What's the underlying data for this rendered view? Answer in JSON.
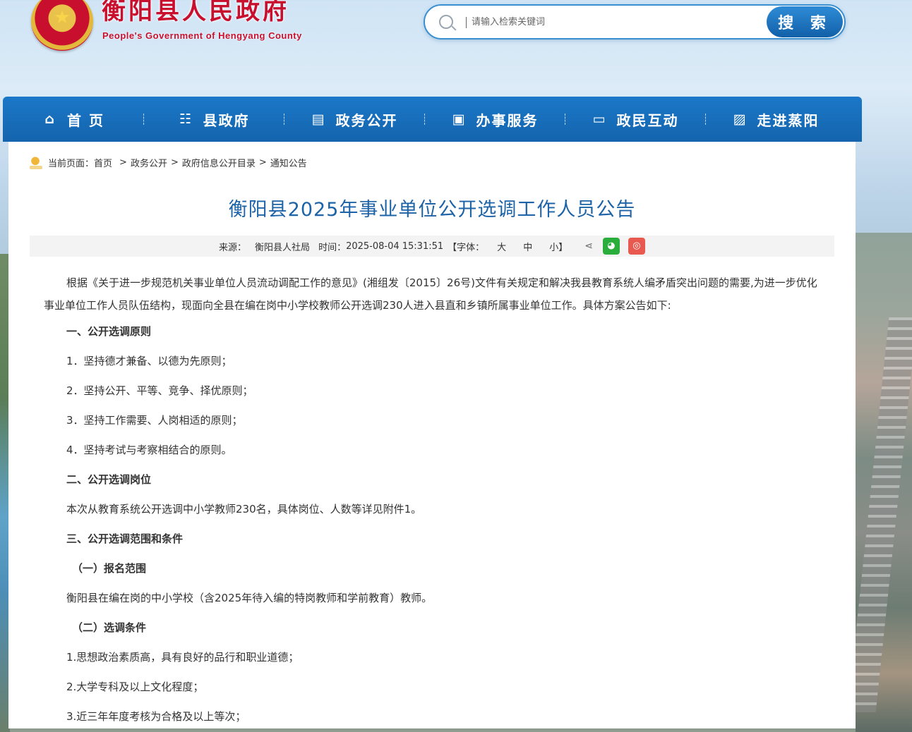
{
  "header": {
    "title": "衡阳县人民政府",
    "subtitle": "People's Government of Hengyang County",
    "search_placeholder": "请输入检索关键词",
    "search_button": "搜 索"
  },
  "nav": [
    {
      "label": "首 页",
      "icon": "home-icon"
    },
    {
      "label": "县政府",
      "icon": "list-icon"
    },
    {
      "label": "政务公开",
      "icon": "document-icon"
    },
    {
      "label": "办事服务",
      "icon": "briefcase-icon"
    },
    {
      "label": "政民互动",
      "icon": "chat-icon"
    },
    {
      "label": "走进蒸阳",
      "icon": "image-icon"
    }
  ],
  "breadcrumb": {
    "prefix": "当前页面：",
    "items": [
      "首页",
      "政务公开",
      "政府信息公开目录",
      "通知公告"
    ],
    "sep": ">"
  },
  "article": {
    "title": "衡阳县2025年事业单位公开选调工作人员公告",
    "meta": {
      "source_label": "来源：",
      "source": "衡阳县人社局",
      "time_label": "时间：",
      "time": "2025-08-04 15:31:51",
      "font_label": "【字体：",
      "font_large": "大",
      "font_medium": "中",
      "font_small": "小】"
    },
    "intro": "根据《关于进一步规范机关事业单位人员流动调配工作的意见》(湘组发〔2015〕26号)文件有关规定和解决我县教育系统人编矛盾突出问题的需要,为进一步优化事业单位工作人员队伍结构，现面向全县在编在岗中小学校教师公开选调230人进入县直和乡镇所属事业单位工作。具体方案公告如下:",
    "p1": "一、公开选调原则",
    "p2": "1．坚持德才兼备、以德为先原则；",
    "p3": "2．坚持公开、平等、竞争、择优原则；",
    "p4": "3．坚持工作需要、人岗相适的原则；",
    "p5": "4．坚持考试与考察相结合的原则。",
    "p6": "二、公开选调岗位",
    "p7": "本次从教育系统公开选调中小学教师230名，具体岗位、人数等详见附件1。",
    "p8": "三、公开选调范围和条件",
    "p9": "（一）报名范围",
    "p10": "衡阳县在编在岗的中小学校（含2025年待入编的特岗教师和学前教育）教师。",
    "p11": "（二）选调条件",
    "p12": "1.思想政治素质高，具有良好的品行和职业道德；",
    "p13": "2.大学专科及以上文化程度；",
    "p14": "3.近三年年度考核为合格及以上等次；"
  }
}
